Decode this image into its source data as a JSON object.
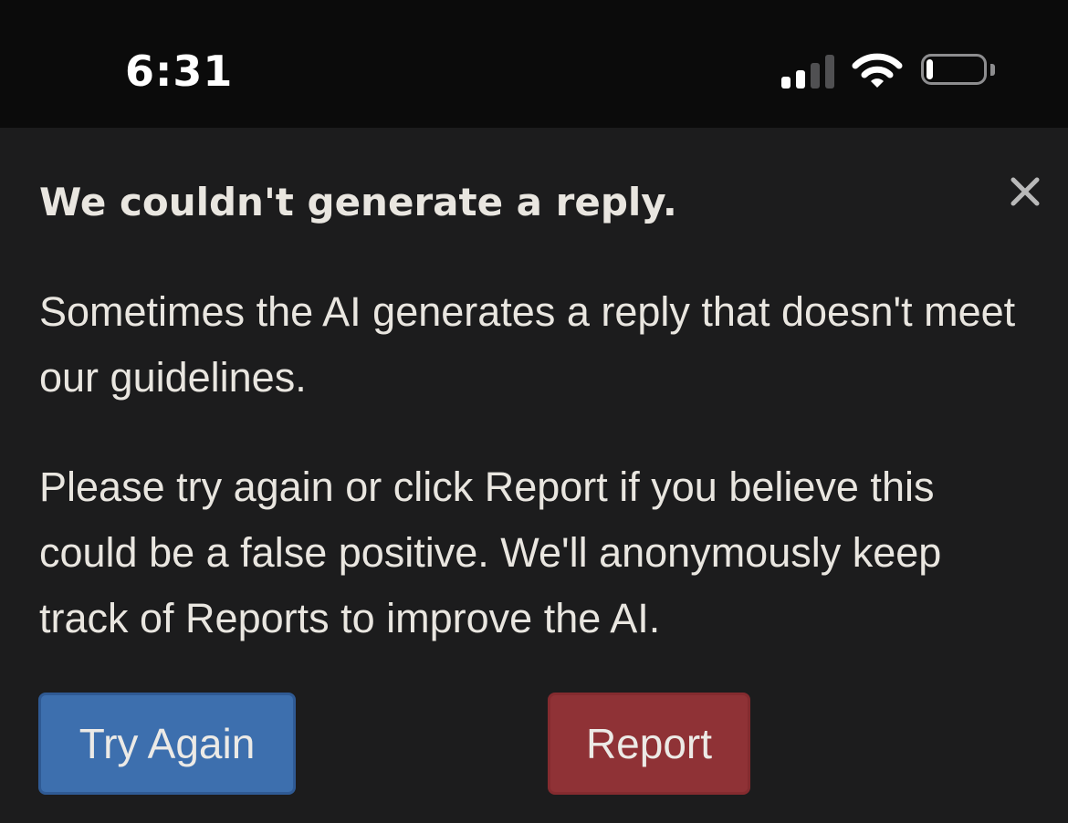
{
  "status_bar": {
    "time": "6:31",
    "signal_icon": "cellular-signal-icon",
    "wifi_icon": "wifi-icon",
    "battery_icon": "battery-low-icon",
    "battery_level": 0.12
  },
  "dialog": {
    "title": "We couldn't generate a reply.",
    "close_icon": "close-icon",
    "paragraph_1": "Sometimes the AI generates a reply that doesn't meet our guidelines.",
    "paragraph_2": "Please try again or click Report if you believe this could be a false positive. We'll anonymously keep track of Reports to improve the AI.",
    "buttons": {
      "try_again": "Try Again",
      "report": "Report"
    }
  },
  "colors": {
    "background": "#1c1c1d",
    "status_bar": "#0b0b0b",
    "text": "#e9e6e0",
    "try_again_button": "#3d6fae",
    "report_button": "#8f3236"
  }
}
